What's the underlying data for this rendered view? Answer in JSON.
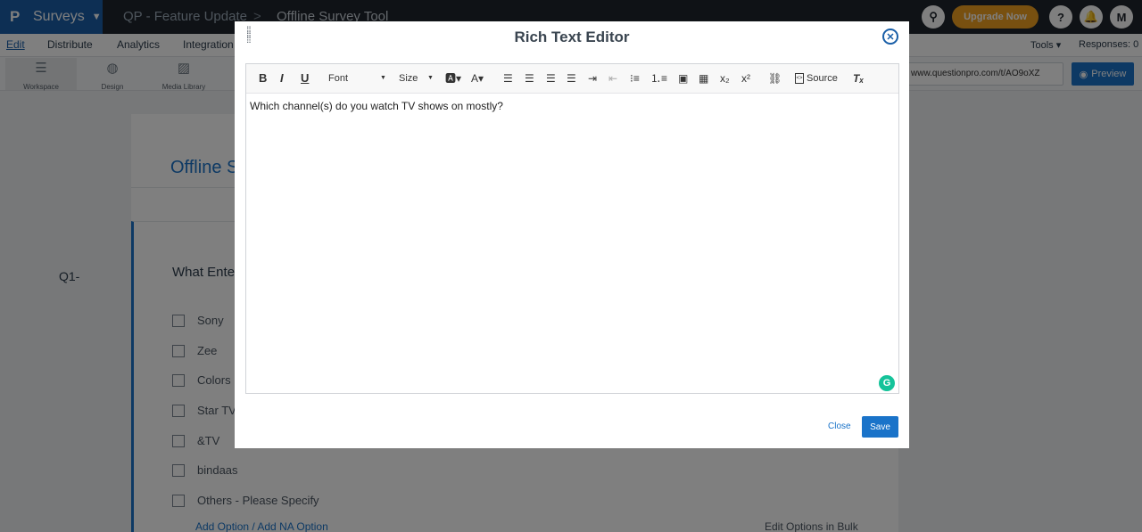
{
  "topbar": {
    "brand_label": "Surveys",
    "crumb_project": "QP - Feature Update",
    "crumb_sep": ">",
    "crumb_survey": "Offline Survey Tool",
    "upgrade_label": "Upgrade Now",
    "help_glyph": "?",
    "user_initial": "M"
  },
  "nav": {
    "items": [
      "Edit",
      "Distribute",
      "Analytics",
      "Integration"
    ],
    "tools_label": "Tools",
    "responses_label": "Responses: 0"
  },
  "toolrow": {
    "items": [
      "Workspace",
      "Design",
      "Media Library"
    ],
    "url": "www.questionpro.com/t/AO9oXZ",
    "preview_label": "Preview"
  },
  "survey": {
    "title": "Offline S",
    "question_number": "Q1-",
    "question_text": "What Ente",
    "options": [
      "Sony",
      "Zee",
      "Colors",
      "Star TV",
      "&TV",
      "bindaas",
      "Others - Please Specify"
    ],
    "add_option_label": "Add Option / Add NA Option",
    "edit_bulk_label": "Edit Options in Bulk"
  },
  "modal": {
    "title": "Rich Text Editor",
    "toolbar": {
      "bold": "B",
      "italic": "I",
      "underline": "U",
      "font_label": "Font",
      "size_label": "Size",
      "source_label": "Source"
    },
    "content_text": "Which channel(s) do you watch TV shows on mostly?",
    "close_label": "Close",
    "save_label": "Save"
  },
  "colors": {
    "brand_blue": "#1a5fa8",
    "accent_blue": "#1a73c9",
    "upgrade_orange": "#f0a020",
    "grammarly_green": "#15c39a"
  }
}
